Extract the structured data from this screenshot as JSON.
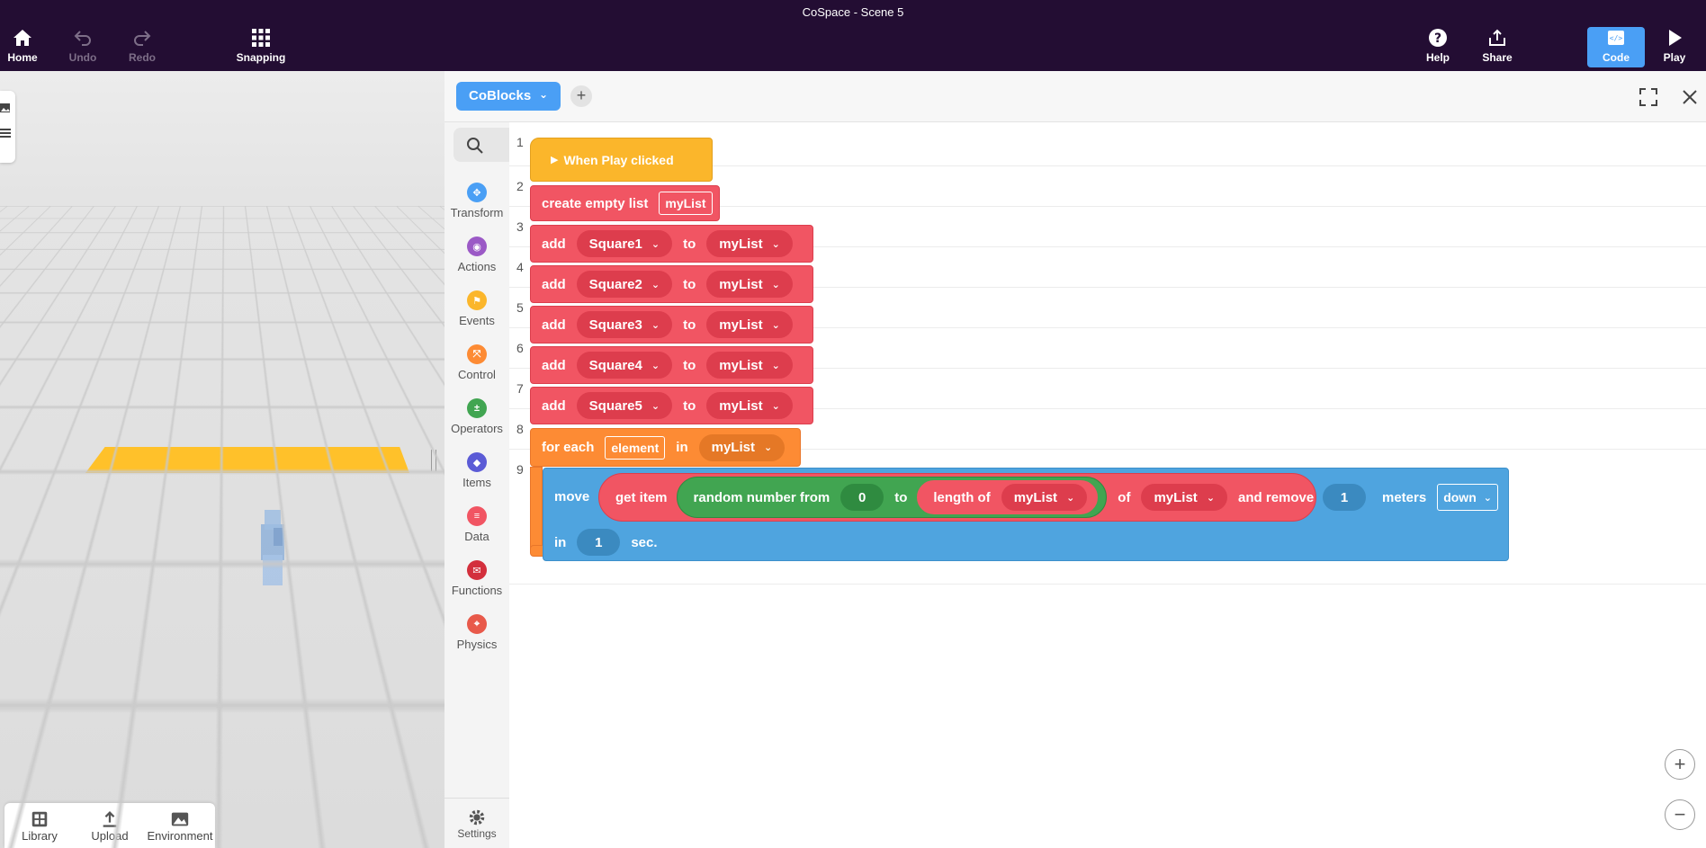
{
  "window": {
    "title": "CoSpace - Scene 5"
  },
  "toolbar": {
    "home": "Home",
    "undo": "Undo",
    "redo": "Redo",
    "snapping": "Snapping",
    "help": "Help",
    "share": "Share",
    "code": "Code",
    "play": "Play"
  },
  "bottombar": {
    "library": "Library",
    "upload": "Upload",
    "environment": "Environment"
  },
  "code": {
    "selector": "CoBlocks",
    "add_label": "+",
    "palette": [
      "Transform",
      "Actions",
      "Events",
      "Control",
      "Operators",
      "Items",
      "Data",
      "Functions",
      "Physics"
    ],
    "palette_colors": [
      "#4a9ff5",
      "#9b59c6",
      "#fbb62b",
      "#fd8b34",
      "#41a551",
      "#5b5bd6",
      "#f15563",
      "#d32f3c",
      "#e8594a"
    ],
    "settings": "Settings",
    "line_numbers": [
      "1",
      "2",
      "3",
      "4",
      "5",
      "6",
      "7",
      "8",
      "9"
    ],
    "blocks": {
      "hat": "When Play clicked",
      "create_list": "create empty list",
      "create_list_var": "myList",
      "add": "add",
      "to": "to",
      "list_name": "myList",
      "items": [
        "Square1",
        "Square2",
        "Square3",
        "Square4",
        "Square5"
      ],
      "for_each": "for each",
      "element": "element",
      "in": "in",
      "move": "move",
      "get_item": "get item",
      "random_from": "random number from",
      "random_min": "0",
      "length_of": "length of",
      "of": "of",
      "and_remove": "and remove",
      "distance": "1",
      "meters": "meters",
      "direction": "down",
      "in_label": "in",
      "seconds": "1",
      "sec": "sec."
    },
    "zoom_in": "+",
    "zoom_out": "−"
  }
}
